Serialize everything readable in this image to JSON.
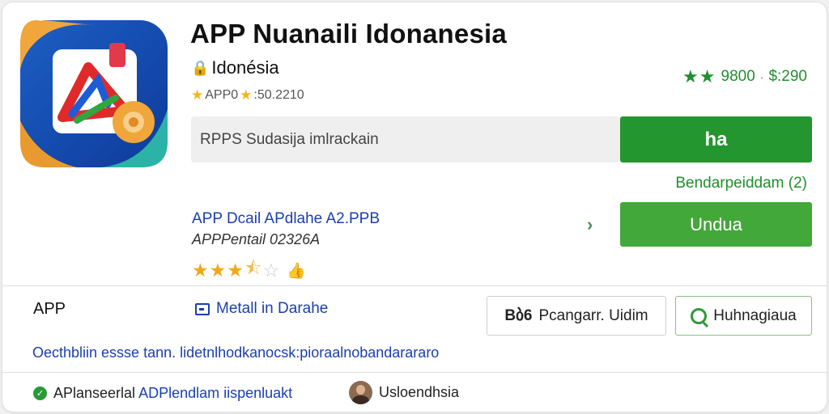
{
  "app": {
    "title": "APP Nuanaili Idonanesia",
    "region": "Idonésia",
    "meta_prefix": "APP0",
    "meta_value": ":50.2210",
    "rating_summary": {
      "stars_icon": "star-icon",
      "count": "9800",
      "separator": "·",
      "price": "$:290"
    }
  },
  "search": {
    "value": "RPPS Sudasija imlrackain"
  },
  "buttons": {
    "primary_label": "ha",
    "download_label": "Undua",
    "pengar_prefix": "Bბ6",
    "pengar_label": "Pcangarr. Uidim",
    "huh_label": "Huhnagiaua"
  },
  "bendar_text": "Bendarpeiddam (2)",
  "details": {
    "link": "APP Dcail APdlahe A2.PPB",
    "sub": "APPPentail 02326A",
    "stars": {
      "full": 3,
      "half": 1,
      "empty": 1
    }
  },
  "section": {
    "label": "APP",
    "metall": "Metall in Darahe",
    "description": "Oecthbliin essse tann. lidetnlhodkanocsk:pioraalnobandarararo"
  },
  "footer": {
    "left_prefix": "APlanseerlal",
    "left_link": "ADPlendlam iispenluakt",
    "right_label": "Usloendhsia"
  },
  "colors": {
    "green_primary": "#23962f",
    "green_download": "#43a83a",
    "link_blue": "#1a3fae",
    "star_gold": "#f0a81a"
  }
}
